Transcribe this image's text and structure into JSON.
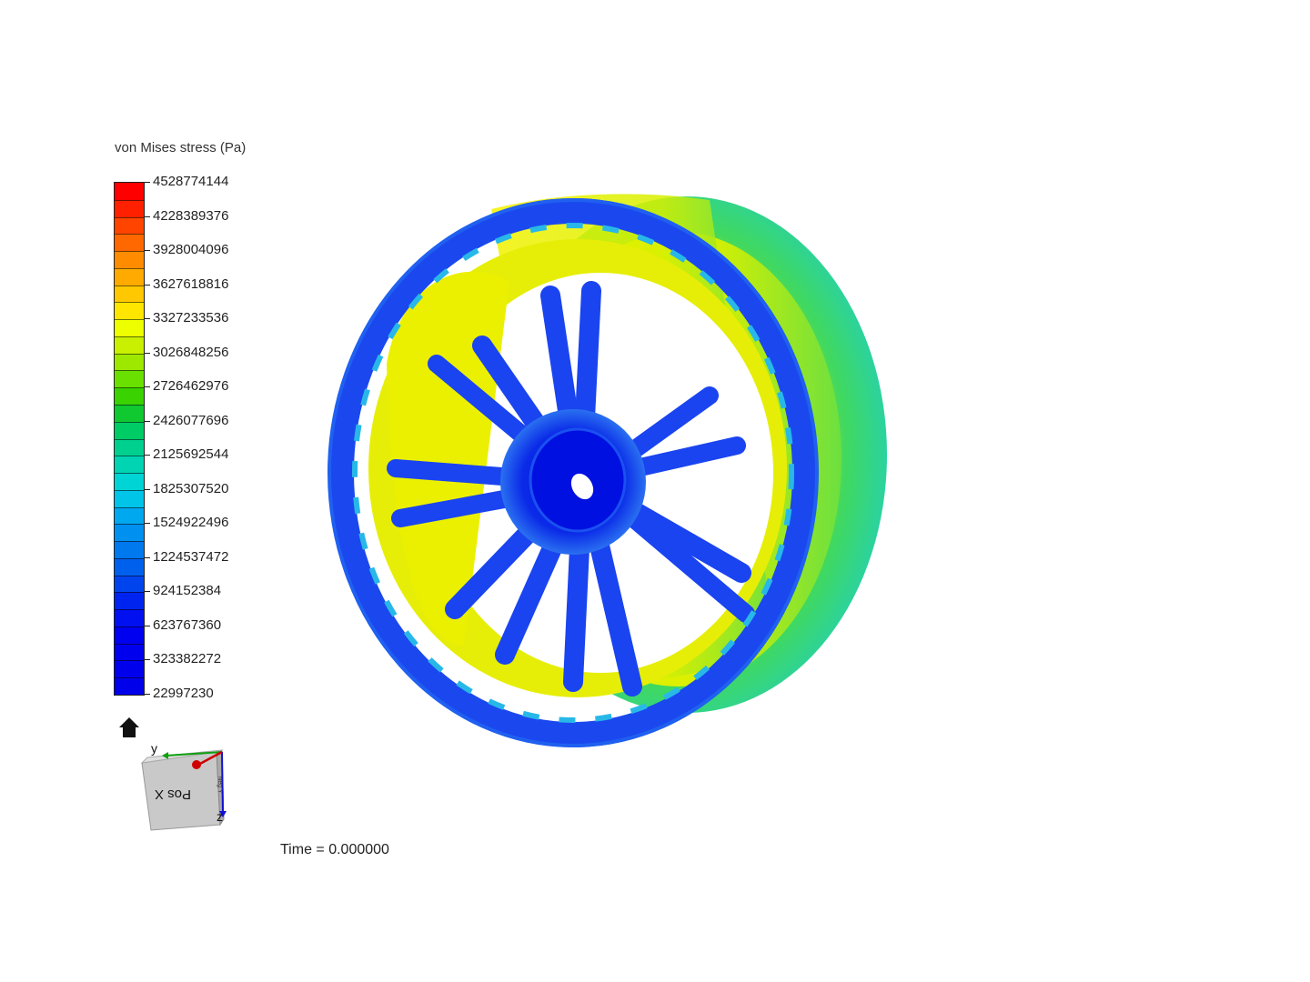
{
  "legend": {
    "title": "von Mises stress (Pa)",
    "ticks": [
      "4528774144",
      "4228389376",
      "3928004096",
      "3627618816",
      "3327233536",
      "3026848256",
      "2726462976",
      "2426077696",
      "2125692544",
      "1825307520",
      "1524922496",
      "1224537472",
      "924152384",
      "623767360",
      "323382272",
      "22997230"
    ],
    "band_colors": [
      "#ff0000",
      "#ff2000",
      "#ff4400",
      "#ff6800",
      "#ff8c00",
      "#ffaa00",
      "#ffc800",
      "#ffe600",
      "#eeff00",
      "#c8f000",
      "#9ee800",
      "#6ae000",
      "#3ad200",
      "#10c830",
      "#00cc66",
      "#00d08e",
      "#00d4b2",
      "#00d4d4",
      "#00c4e8",
      "#00a8f0",
      "#0090f0",
      "#0078ee",
      "#0060ee",
      "#0044ee",
      "#0024f0",
      "#0010f0",
      "#0000f0",
      "#0000ee",
      "#0000ec",
      "#0000ea"
    ]
  },
  "viewer": {
    "home_icon": "home-icon",
    "cube": {
      "face_label": "Pos X",
      "side_label": "Neg Y",
      "axis_y": "y",
      "axis_z": "z",
      "colors": {
        "x_axis": "#d00000",
        "y_axis": "#10a010",
        "z_axis": "#1010d0"
      }
    },
    "time_text": "Time = 0.000000"
  },
  "colors": {
    "high": "#ff0000",
    "mid": "#ffff00",
    "low": "#0000ee"
  }
}
